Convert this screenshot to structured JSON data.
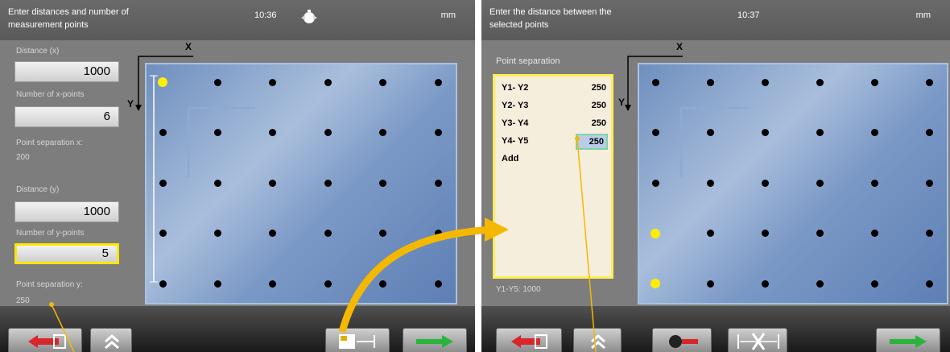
{
  "screen1": {
    "title": "Enter distances and number of measurement points",
    "time": "10:36",
    "unit": "mm",
    "distance_x_label": "Distance (x)",
    "distance_x_value": "1000",
    "num_x_label": "Number of x-points",
    "num_x_value": "6",
    "sep_x_label": "Point separation x:",
    "sep_x_value": "200",
    "distance_y_label": "Distance (y)",
    "distance_y_value": "1000",
    "num_y_label": "Number of y-points",
    "num_y_value": "5",
    "sep_y_label": "Point separation y:",
    "sep_y_value": "250",
    "axis_x": "X",
    "axis_y": "Y",
    "grid_columns": 6,
    "grid_rows": 5
  },
  "screen2": {
    "title": "Enter the distance between the selected points",
    "time": "10:37",
    "unit": "mm",
    "panel_title": "Point separation",
    "rows": [
      {
        "label": "Y1- Y2",
        "value": "250"
      },
      {
        "label": "Y2- Y3",
        "value": "250"
      },
      {
        "label": "Y3- Y4",
        "value": "250"
      },
      {
        "label": "Y4- Y5",
        "value": "250"
      }
    ],
    "add_label": "Add",
    "total": "Y1-Y5: 1000",
    "axis_x": "X",
    "axis_y": "Y",
    "grid_columns": 6,
    "grid_rows": 5
  },
  "icons": {
    "back": "exit-arrow-icon",
    "menu": "double-chevron-up-icon",
    "measure": "distance-measure-icon",
    "next": "right-arrow-icon",
    "laser": "laser-icon",
    "cross": "cross-distance-icon",
    "stopwatch": "stopwatch-icon"
  },
  "colors": {
    "highlight": "#ffee00",
    "plate": "#7b99c6",
    "arrow": "#f5b800"
  }
}
